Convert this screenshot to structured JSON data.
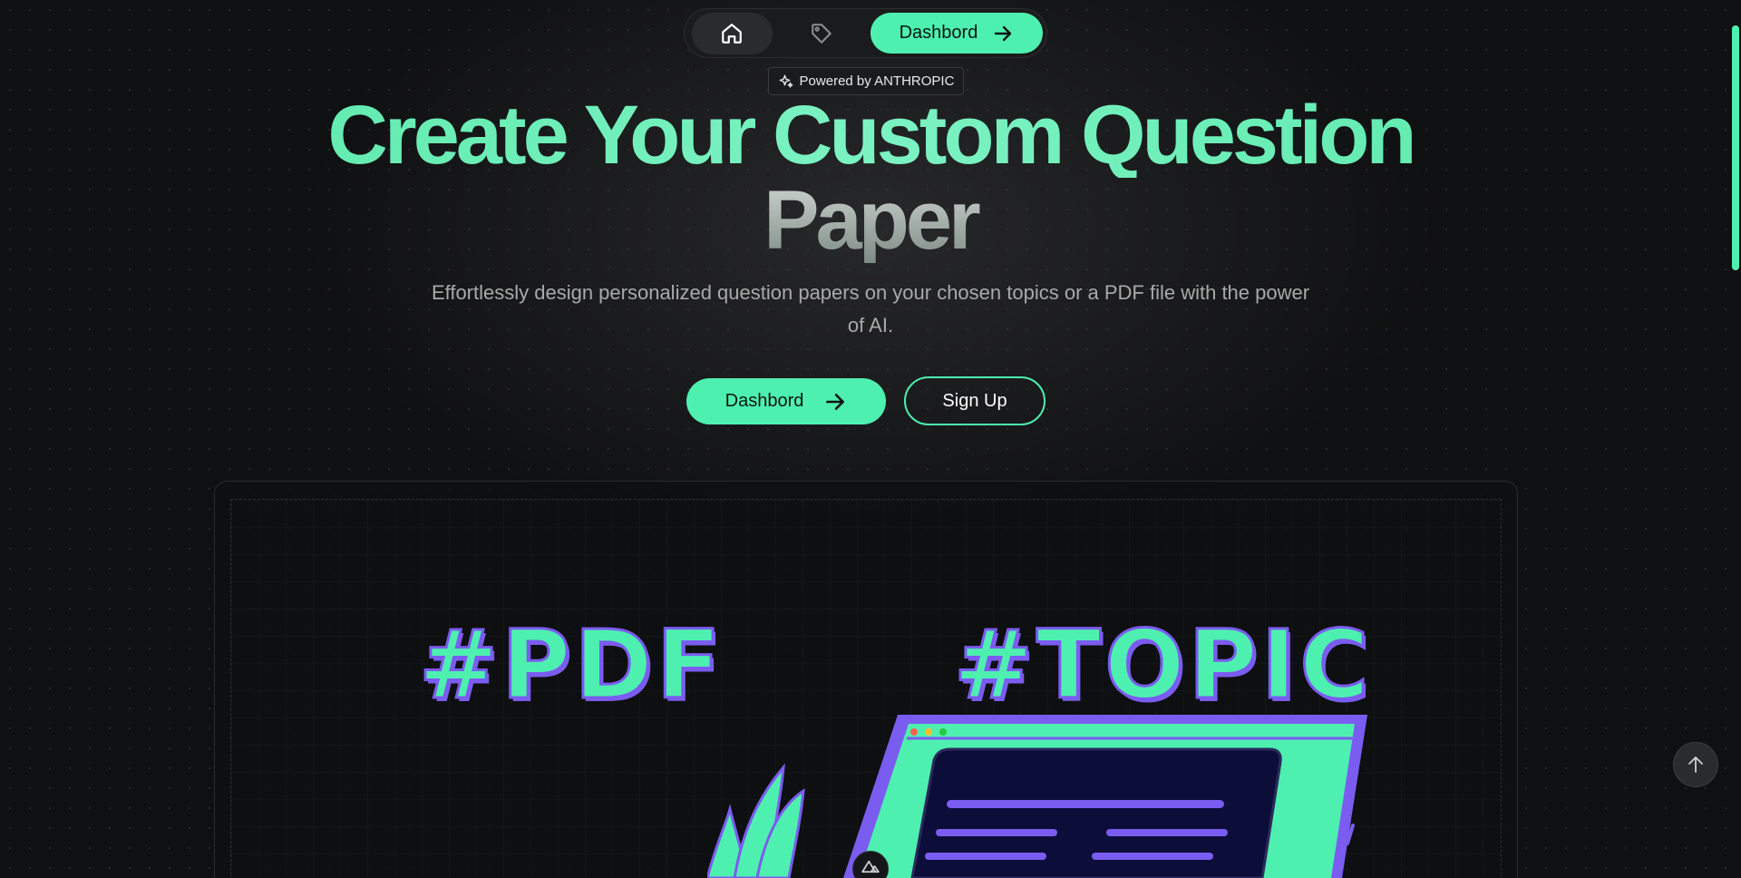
{
  "nav": {
    "home_icon": "home-icon",
    "tag_icon": "tag-icon",
    "dashboard_label": "Dashbord",
    "arrow_icon": "arrow-right-icon"
  },
  "badge": {
    "icon": "sparkles-icon",
    "label": "Powered by ANTHROPIC"
  },
  "hero": {
    "title_line1": "Create Your Custom Question",
    "title_line2": "Paper",
    "subtitle": "Effortlessly design personalized question papers on your chosen topics or a PDF file with the power of AI.",
    "primary_button": "Dashbord",
    "secondary_button": "Sign Up"
  },
  "showcase": {
    "tag_pdf": "#PDF",
    "tag_topic": "#TOPIC"
  },
  "colors": {
    "accent": "#4ef0b0",
    "purple": "#7b5cf0",
    "background": "#0f1011"
  }
}
